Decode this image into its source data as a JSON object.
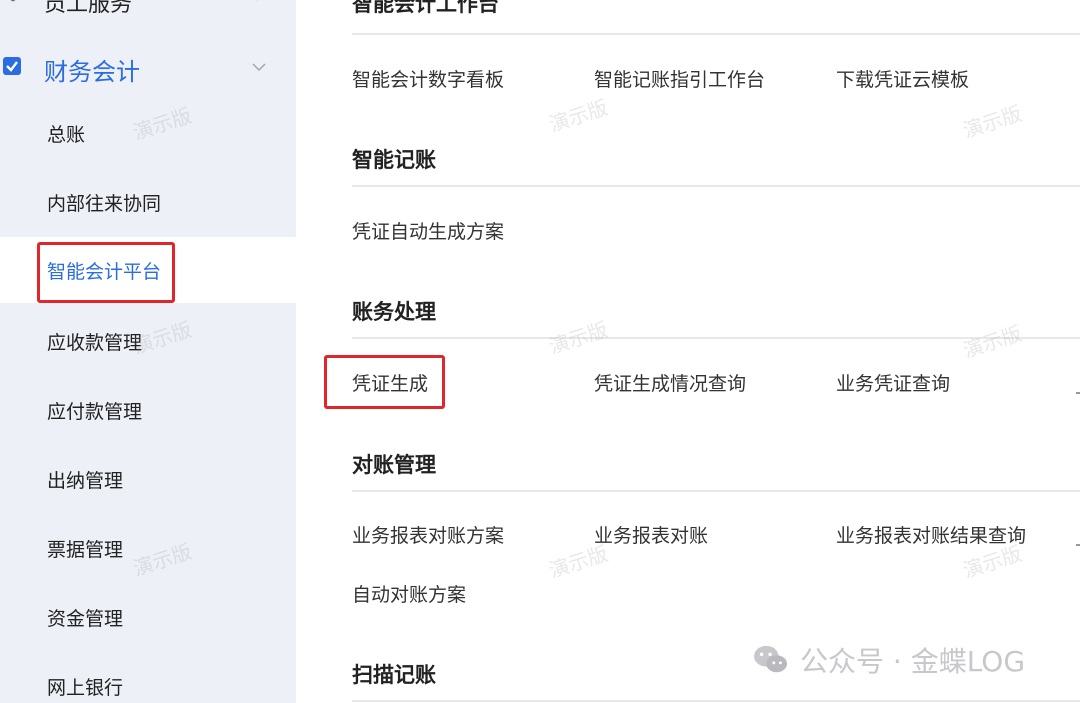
{
  "sidebar": {
    "top_item_label": "员工服务",
    "group_label": "财务会计",
    "items": [
      {
        "label": "总账"
      },
      {
        "label": "内部往来协同"
      },
      {
        "label": "智能会计平台"
      },
      {
        "label": "应收款管理"
      },
      {
        "label": "应付款管理"
      },
      {
        "label": "出纳管理"
      },
      {
        "label": "票据管理"
      },
      {
        "label": "资金管理"
      },
      {
        "label": "网上银行"
      }
    ]
  },
  "watermark_text": "演示版",
  "main": {
    "sections": [
      {
        "title": "智能会计工作台",
        "links": [
          "智能会计数字看板",
          "智能记账指引工作台",
          "下载凭证云模板"
        ]
      },
      {
        "title": "智能记账",
        "links": [
          "凭证自动生成方案"
        ]
      },
      {
        "title": "账务处理",
        "links": [
          "凭证生成",
          "凭证生成情况查询",
          "业务凭证查询"
        ]
      },
      {
        "title": "对账管理",
        "links": [
          "业务报表对账方案",
          "业务报表对账",
          "业务报表对账结果查询",
          "自动对账方案"
        ]
      },
      {
        "title": "扫描记账",
        "links": []
      }
    ]
  },
  "footer": {
    "brand_text": "公众号 · 金蝶LOG",
    "icon": "wechat-icon"
  },
  "colors": {
    "accent": "#2b6ce0",
    "highlight": "#e0262a",
    "sidebar_bg": "#eef0f7"
  }
}
